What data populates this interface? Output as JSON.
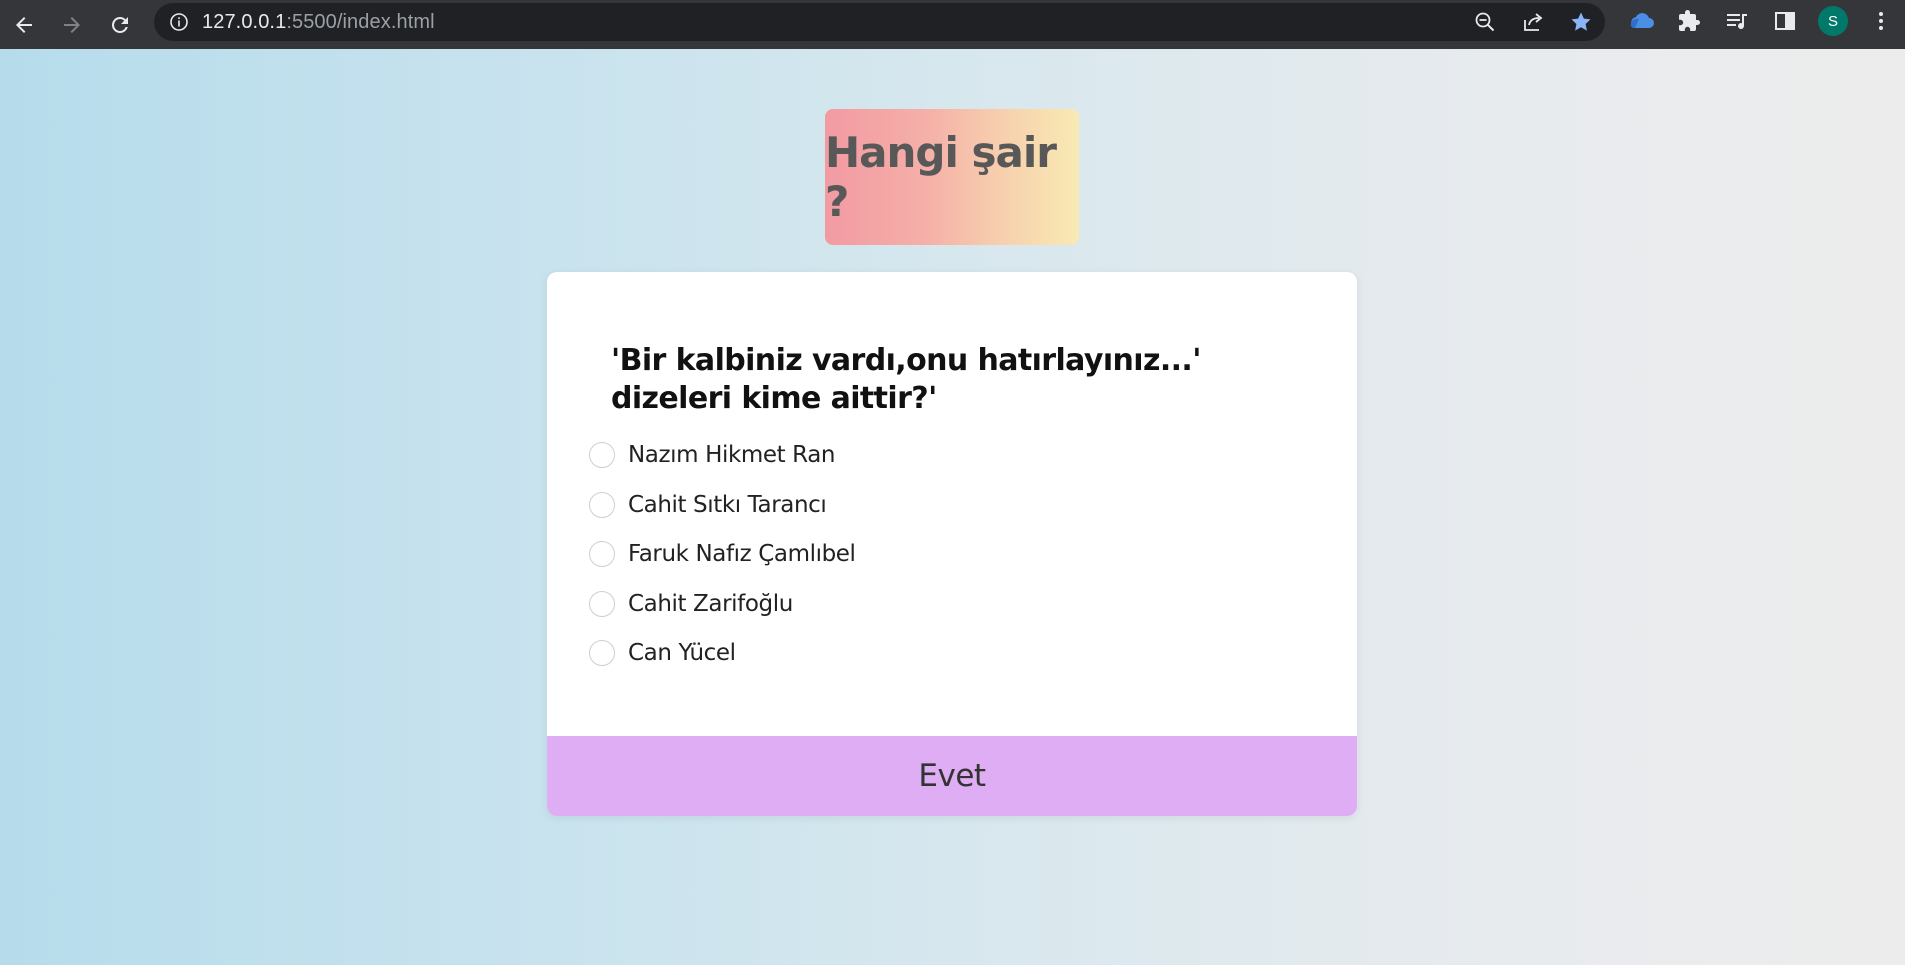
{
  "browser": {
    "url_host": "127.0.0.1",
    "url_path": ":5500/index.html",
    "avatar_initial": "S",
    "icons": {
      "back": "arrow-left-icon",
      "forward": "arrow-right-icon",
      "reload": "reload-icon",
      "site_info": "info-icon",
      "zoom": "zoom-out-icon",
      "share": "share-icon",
      "bookmark": "star-icon",
      "extension_cloud": "cloud-extension-icon",
      "extensions": "puzzle-icon",
      "media": "media-queue-icon",
      "side_panel": "side-panel-icon",
      "menu": "kebab-menu-icon"
    },
    "colors": {
      "chrome_bg": "#35363a",
      "omnibox_bg": "#202124",
      "bookmark_star": "#8ab4f8",
      "avatar_bg": "#00796b"
    }
  },
  "header": {
    "title": "Hangi şair ?"
  },
  "quiz": {
    "question": "'Bir kalbiniz vardı,onu hatırlayınız...' dizeleri kime aittir?'",
    "options": [
      "Nazım Hikmet Ran",
      "Cahit Sıtkı Tarancı",
      "Faruk Nafız Çamlıbel",
      "Cahit Zarifoğlu",
      "Can Yücel"
    ],
    "submit_label": "Evet"
  },
  "colors": {
    "submit_bg": "#dfadf4",
    "title_gradient_start": "#f29aa3",
    "title_gradient_end": "#f8eab3"
  }
}
